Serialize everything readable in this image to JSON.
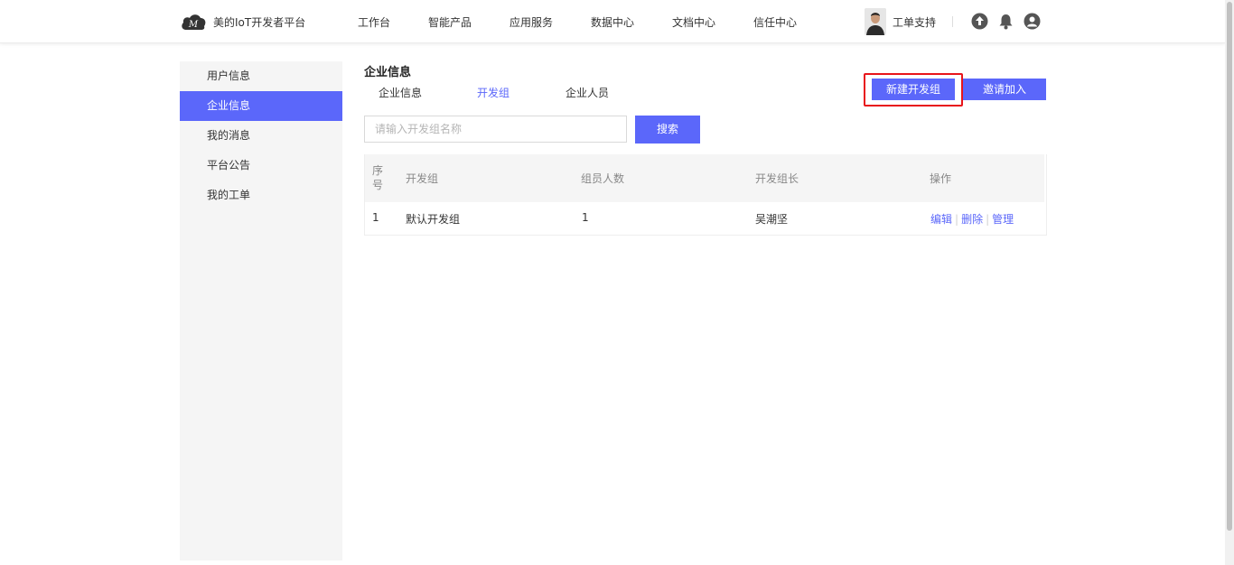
{
  "header": {
    "brand": "美的IoT开发者平台",
    "nav": [
      "工作台",
      "智能产品",
      "应用服务",
      "数据中心",
      "文档中心",
      "信任中心"
    ],
    "support_label": "工单支持",
    "icons": [
      "upload-icon",
      "bell-icon",
      "user-icon"
    ]
  },
  "sidebar": {
    "items": [
      {
        "label": "用户信息",
        "active": false
      },
      {
        "label": "企业信息",
        "active": true
      },
      {
        "label": "我的消息",
        "active": false
      },
      {
        "label": "平台公告",
        "active": false
      },
      {
        "label": "我的工单",
        "active": false
      }
    ]
  },
  "main": {
    "title": "企业信息",
    "tabs": [
      {
        "label": "企业信息",
        "active": false
      },
      {
        "label": "开发组",
        "active": true
      },
      {
        "label": "企业人员",
        "active": false
      }
    ],
    "buttons": {
      "new_group": "新建开发组",
      "invite": "邀请加入",
      "search": "搜索"
    },
    "search": {
      "placeholder": "请输入开发组名称",
      "value": ""
    },
    "table": {
      "columns": [
        "序号",
        "开发组",
        "组员人数",
        "开发组长",
        "操作"
      ],
      "rows": [
        {
          "index": "1",
          "group": "默认开发组",
          "members": "1",
          "leader": "吴潮坚"
        }
      ],
      "actions": [
        "编辑",
        "删除",
        "管理"
      ]
    }
  },
  "colors": {
    "accent": "#5b67fa",
    "highlight": "#e8141b",
    "sidebar_bg": "#f5f5f5"
  }
}
